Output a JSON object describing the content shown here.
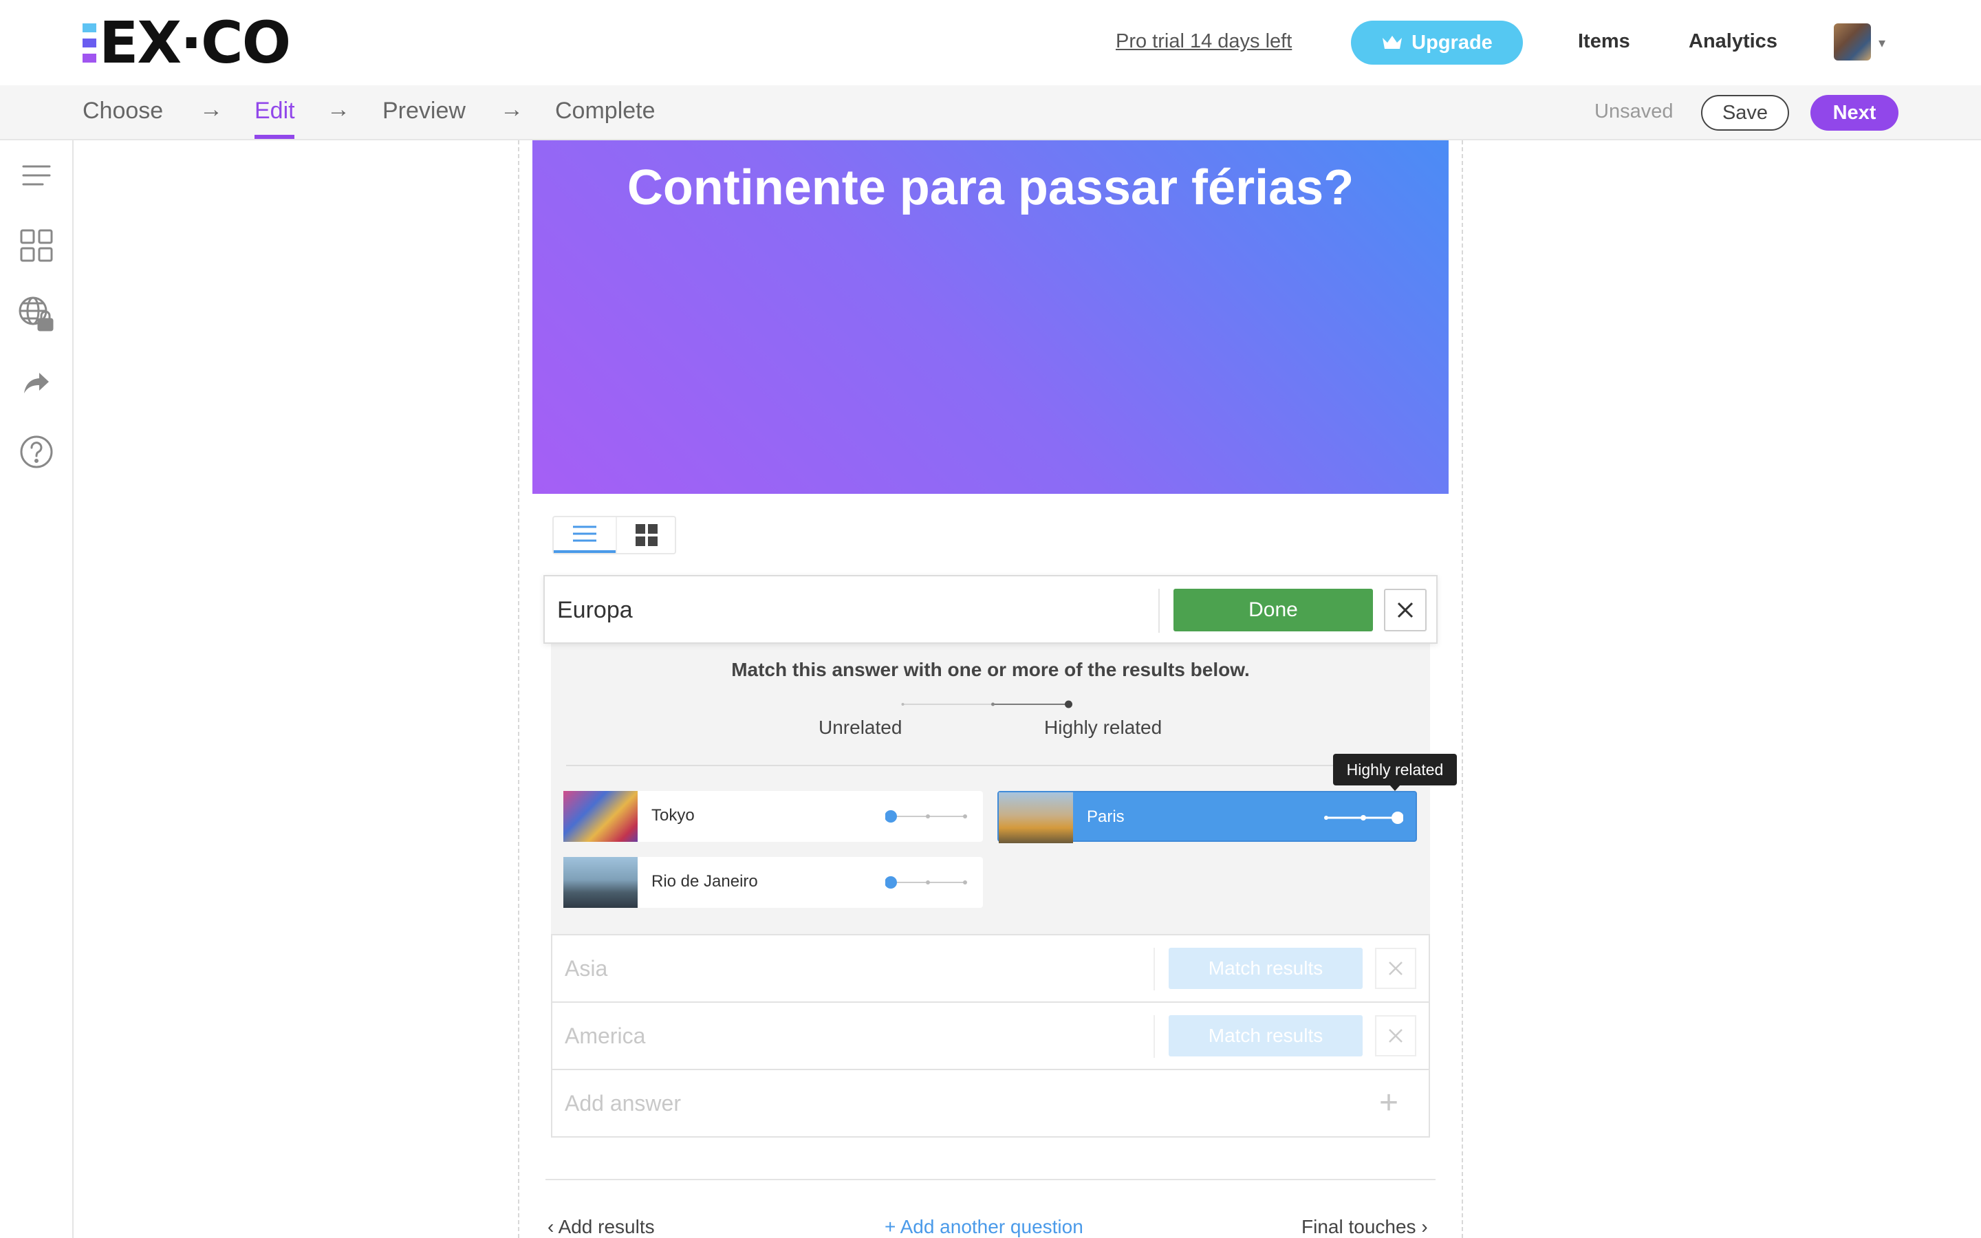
{
  "header": {
    "logo_text": "EX·CO",
    "trial_link": "Pro trial 14 days left",
    "upgrade_label": "Upgrade",
    "nav": [
      "Items",
      "Analytics"
    ]
  },
  "steps": {
    "items": [
      "Choose",
      "Edit",
      "Preview",
      "Complete"
    ],
    "active": "Edit",
    "arrow": "→",
    "status": "Unsaved",
    "save_label": "Save",
    "next_label": "Next"
  },
  "sidebar": {
    "icons": [
      "menu-icon",
      "grid-icon",
      "globe-lock-icon",
      "share-icon",
      "help-icon"
    ]
  },
  "question": {
    "title": "Continente para passar férias?"
  },
  "view_toggle": {
    "options": [
      "list-view-icon",
      "grid-view-icon"
    ],
    "selected": "list"
  },
  "active_answer": {
    "value": "Europa",
    "done_label": "Done",
    "instruction": "Match this answer with one or more of the results below.",
    "legend_low": "Unrelated",
    "legend_high": "Highly related",
    "results": [
      {
        "name": "Tokyo",
        "relation_level": 0,
        "selected": false
      },
      {
        "name": "Paris",
        "relation_level": 2,
        "selected": true
      },
      {
        "name": "Rio de Janeiro",
        "relation_level": 0,
        "selected": false
      }
    ],
    "tooltip": "Highly related"
  },
  "answers": [
    {
      "value": "Asia",
      "match_label": "Match results"
    },
    {
      "value": "America",
      "match_label": "Match results"
    }
  ],
  "add_answer_placeholder": "Add answer",
  "footer": {
    "prev_label": "Add results",
    "add_label": "+ Add another question",
    "next_label": "Final touches"
  },
  "colors": {
    "brand_purple": "#9147ea",
    "accent_blue": "#4a9ae9",
    "done_green": "#4ca24f",
    "upgrade_cyan": "#55c8f2",
    "hero_gradient_start": "#a55ff5",
    "hero_gradient_end": "#4b8cf5"
  }
}
